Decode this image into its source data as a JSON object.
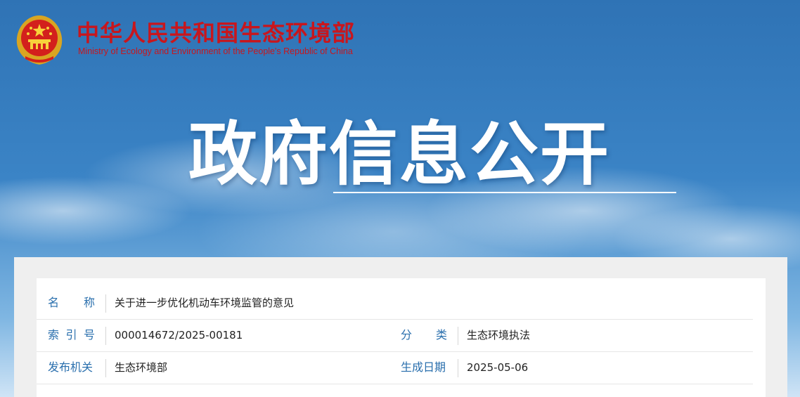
{
  "header": {
    "title": "中华人民共和国生态环境部",
    "subtitle": "Ministry of Ecology and Environment of the People's Republic of China",
    "emblem_icon": "national-emblem-icon"
  },
  "hero": {
    "title": "政府信息公开"
  },
  "colors": {
    "brand_red": "#c8161d",
    "label_blue": "#2a6fad",
    "sky_blue": "#3f86c4"
  },
  "info": {
    "name": {
      "label": "名称",
      "value": "关于进一步优化机动车环境监管的意见"
    },
    "index": {
      "label": "索引号",
      "value": "000014672/2025-00181"
    },
    "category": {
      "label": "分类",
      "value": "生态环境执法"
    },
    "issuer": {
      "label": "发布机关",
      "value": "生态环境部"
    },
    "date": {
      "label": "生成日期",
      "value": "2025-05-06"
    }
  }
}
